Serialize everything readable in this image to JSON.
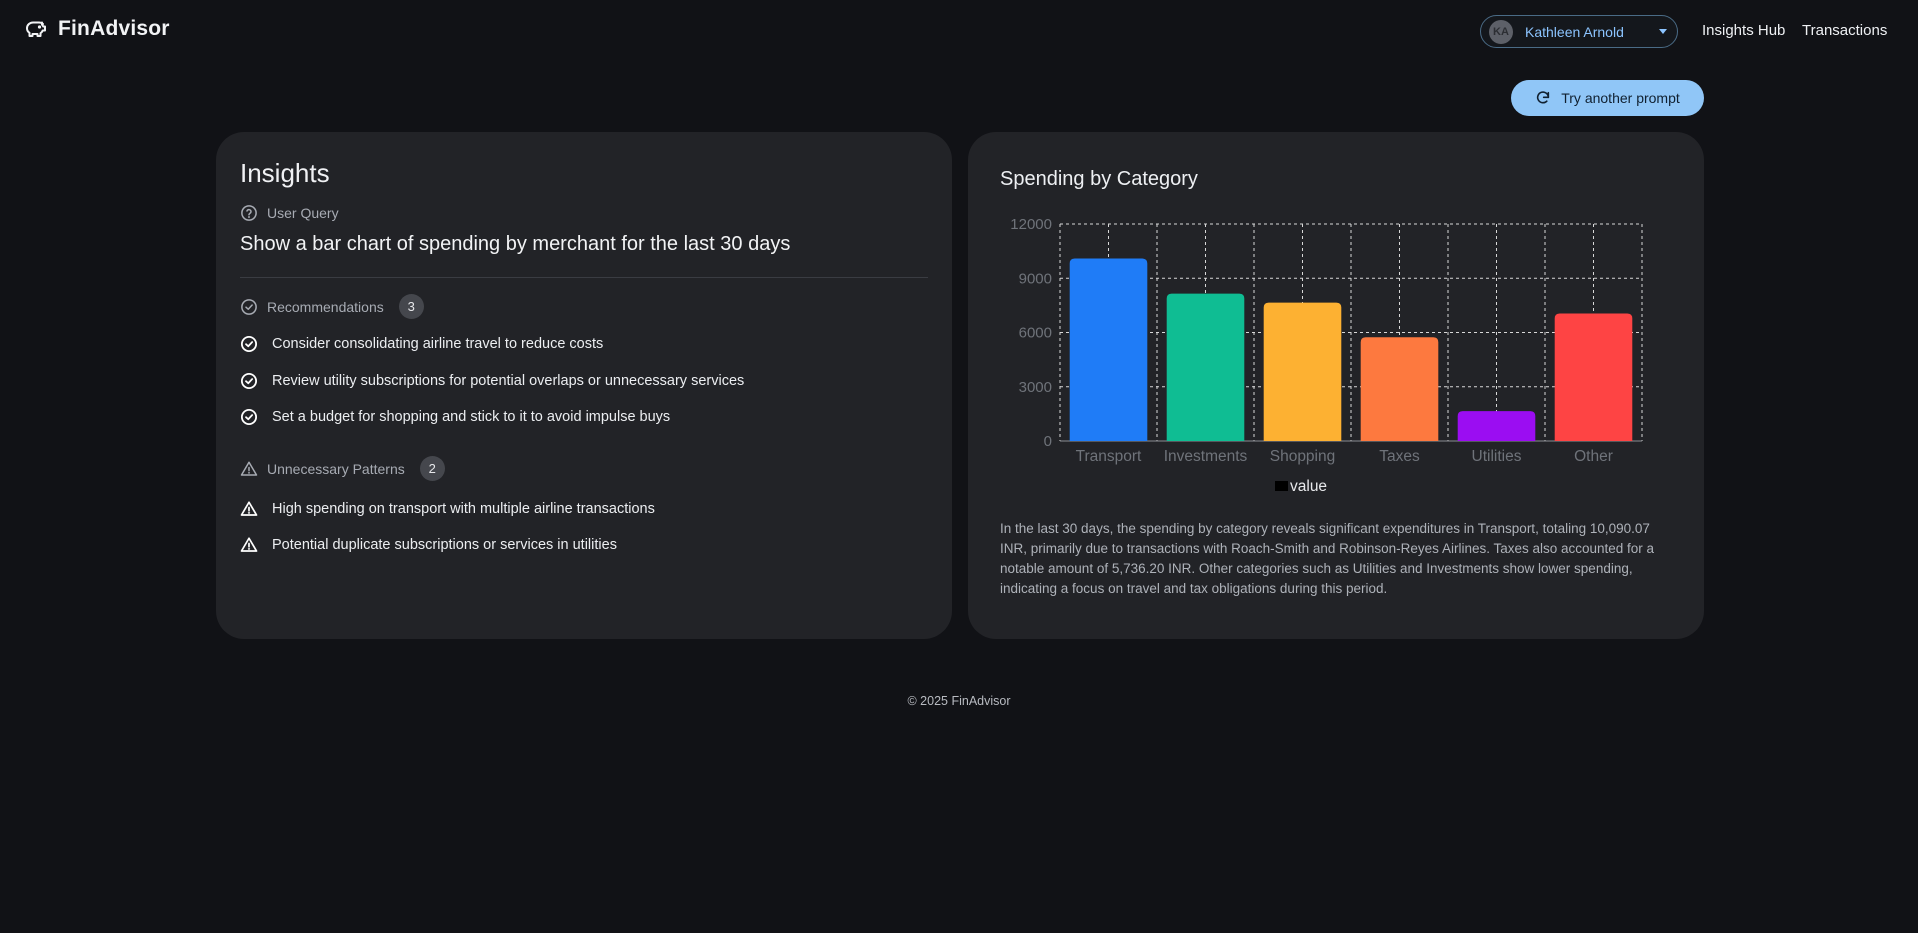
{
  "app": {
    "title": "FinAdvisor"
  },
  "header": {
    "user_initials": "KA",
    "user_name": "Kathleen Arnold",
    "nav": [
      "Insights Hub",
      "Transactions"
    ]
  },
  "try_button_label": "Try another prompt",
  "insights": {
    "title": "Insights",
    "query_label": "User Query",
    "query_text": "Show a bar chart of spending by merchant for the last 30 days",
    "recommendations_label": "Recommendations",
    "recommendations_count": "3",
    "recommendations": [
      "Consider consolidating airline travel to reduce costs",
      "Review utility subscriptions for potential overlaps or unnecessary services",
      "Set a budget for shopping and stick to it to avoid impulse buys"
    ],
    "patterns_label": "Unnecessary Patterns",
    "patterns_count": "2",
    "patterns": [
      "High spending on transport with multiple airline transactions",
      "Potential duplicate subscriptions or services in utilities"
    ]
  },
  "chart_card": {
    "summary": "In the last 30 days, the spending by category reveals significant expenditures in Transport, totaling 10,090.07 INR, primarily due to transactions with Roach-Smith and Robinson-Reyes Airlines. Taxes also accounted for a notable amount of 5,736.20 INR. Other categories such as Utilities and Investments show lower spending, indicating a focus on travel and tax obligations during this period."
  },
  "chart_data": {
    "type": "bar",
    "title": "Spending by Category",
    "categories": [
      "Transport",
      "Investments",
      "Shopping",
      "Taxes",
      "Utilities",
      "Other"
    ],
    "series": [
      {
        "name": "value",
        "values": [
          10090.07,
          8150,
          7650,
          5736.2,
          1650,
          7050
        ]
      }
    ],
    "colors": [
      "#1f7cf7",
      "#0fbd93",
      "#fdb132",
      "#fd793f",
      "#9b0df2",
      "#fe4444"
    ],
    "ylim": [
      0,
      12000
    ],
    "yticks": [
      "0",
      "3000",
      "6000",
      "9000",
      "12000"
    ],
    "grid": true,
    "legend": "bottom",
    "xlabel": "",
    "ylabel": ""
  },
  "footer": "© 2025 FinAdvisor"
}
